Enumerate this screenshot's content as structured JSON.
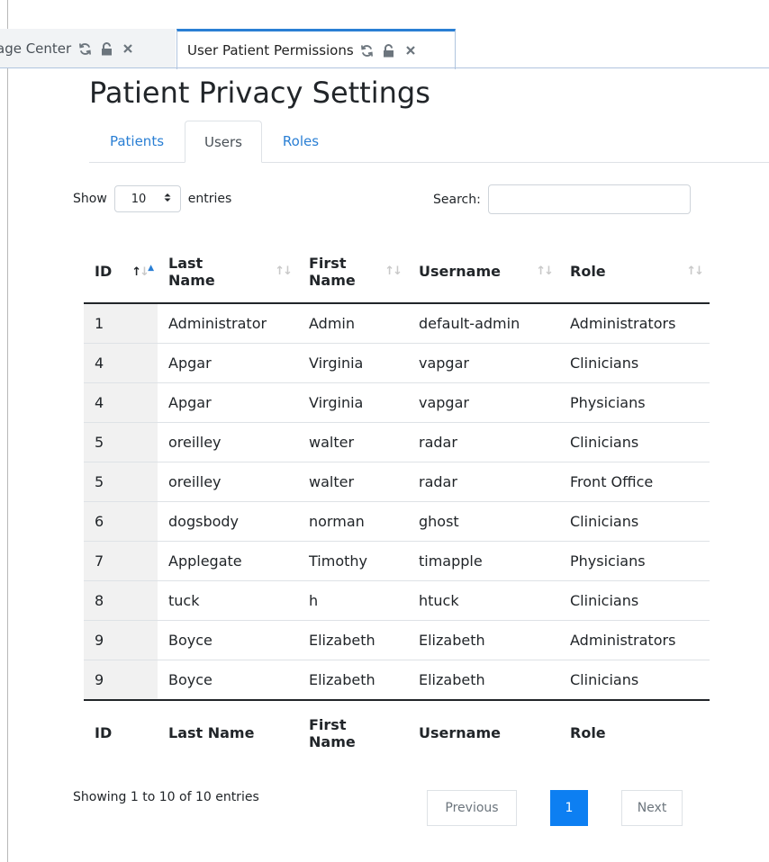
{
  "tabs": [
    {
      "label": "age Center"
    },
    {
      "label": "User Patient Permissions"
    }
  ],
  "page": {
    "title": "Patient Privacy Settings"
  },
  "subtabs": [
    {
      "label": "Patients"
    },
    {
      "label": "Users"
    },
    {
      "label": "Roles"
    }
  ],
  "length": {
    "show_label": "Show",
    "value": "10",
    "entries_label": "entries"
  },
  "search": {
    "label": "Search:",
    "value": "",
    "placeholder": ""
  },
  "table": {
    "headers": [
      {
        "l1": "ID",
        "l2": ""
      },
      {
        "l1": "Last",
        "l2": "Name"
      },
      {
        "l1": "First",
        "l2": "Name"
      },
      {
        "l1": "Username",
        "l2": ""
      },
      {
        "l1": "Role",
        "l2": ""
      }
    ],
    "rows": [
      [
        "1",
        "Administrator",
        "Admin",
        "default-admin",
        "Administrators"
      ],
      [
        "4",
        "Apgar",
        "Virginia",
        "vapgar",
        "Clinicians"
      ],
      [
        "4",
        "Apgar",
        "Virginia",
        "vapgar",
        "Physicians"
      ],
      [
        "5",
        "oreilley",
        "walter",
        "radar",
        "Clinicians"
      ],
      [
        "5",
        "oreilley",
        "walter",
        "radar",
        "Front Office"
      ],
      [
        "6",
        "dogsbody",
        "norman",
        "ghost",
        "Clinicians"
      ],
      [
        "7",
        "Applegate",
        "Timothy",
        "timapple",
        "Physicians"
      ],
      [
        "8",
        "tuck",
        "h",
        "htuck",
        "Clinicians"
      ],
      [
        "9",
        "Boyce",
        "Elizabeth",
        "Elizabeth",
        "Administrators"
      ],
      [
        "9",
        "Boyce",
        "Elizabeth",
        "Elizabeth",
        "Clinicians"
      ]
    ],
    "footer": [
      {
        "l1": "ID",
        "l2": ""
      },
      {
        "l1": "Last Name",
        "l2": ""
      },
      {
        "l1": "First",
        "l2": "Name"
      },
      {
        "l1": "Username",
        "l2": ""
      },
      {
        "l1": "Role",
        "l2": ""
      }
    ]
  },
  "info": "Showing 1 to 10 of 10 entries",
  "pagination": {
    "previous": "Previous",
    "current": "1",
    "next": "Next"
  },
  "colors": {
    "accent": "#2a7fd4",
    "active_page": "#0d7ff2"
  }
}
